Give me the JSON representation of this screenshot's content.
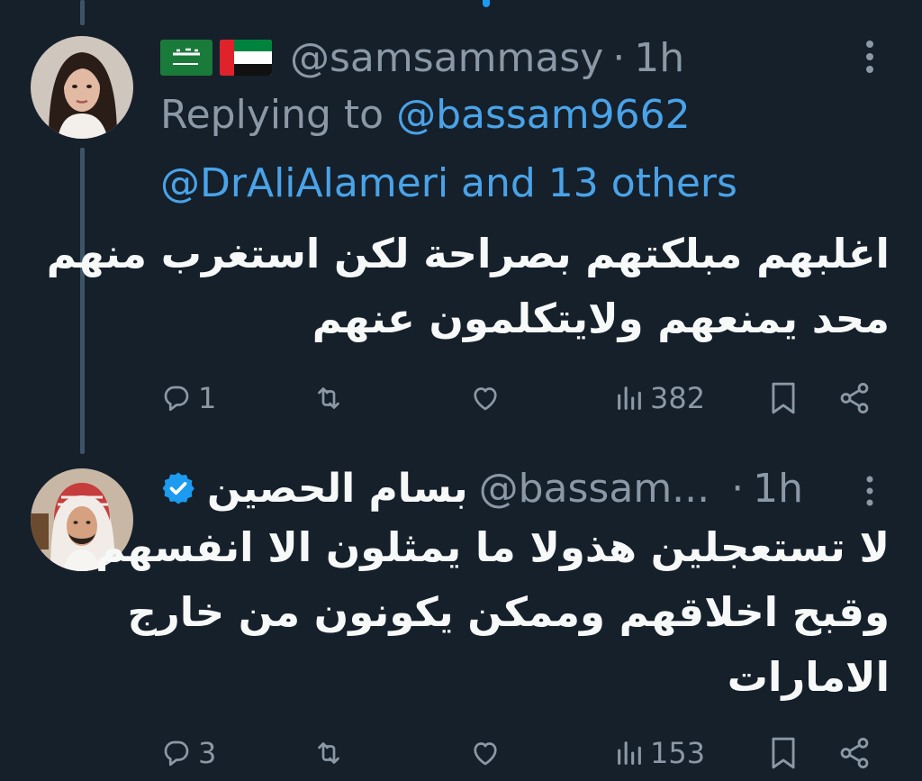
{
  "tweet1": {
    "avatar_label": "samsammasy avatar",
    "flags": [
      "saudi-flag-icon",
      "uae-flag-icon"
    ],
    "handle": "@samsammasy",
    "separator": "·",
    "time": "1h",
    "replying_prefix": "Replying to",
    "replying_user": "@bassam9662",
    "replying_more": "@DrAliAlameri and 13 others",
    "text_line1": "اغلبهم مبلكتهم بصراحة لكن استغرب منهم",
    "text_line2": "محد يمنعهم ولايتكلمون عنهم",
    "reply_count": "1",
    "view_count": "382"
  },
  "tweet2": {
    "avatar_label": "bassam avatar",
    "display_name": "بسام الحصين",
    "handle": "@bassam...",
    "separator": "·",
    "time": "1h",
    "text_line1": "لا تستعجلين هذولا ما يمثلون الا انفسهم",
    "text_line2": "وقبح اخلاقهم وممكن يكونون من خارج",
    "text_line3": "الامارات",
    "reply_count": "3",
    "view_count": "153"
  },
  "colors": {
    "background": "#15202b",
    "text": "#f7f9f9",
    "muted": "#8b98a5",
    "link": "#4aa3e8",
    "verified": "#1d9bf0",
    "thread_line": "#3d5466"
  }
}
